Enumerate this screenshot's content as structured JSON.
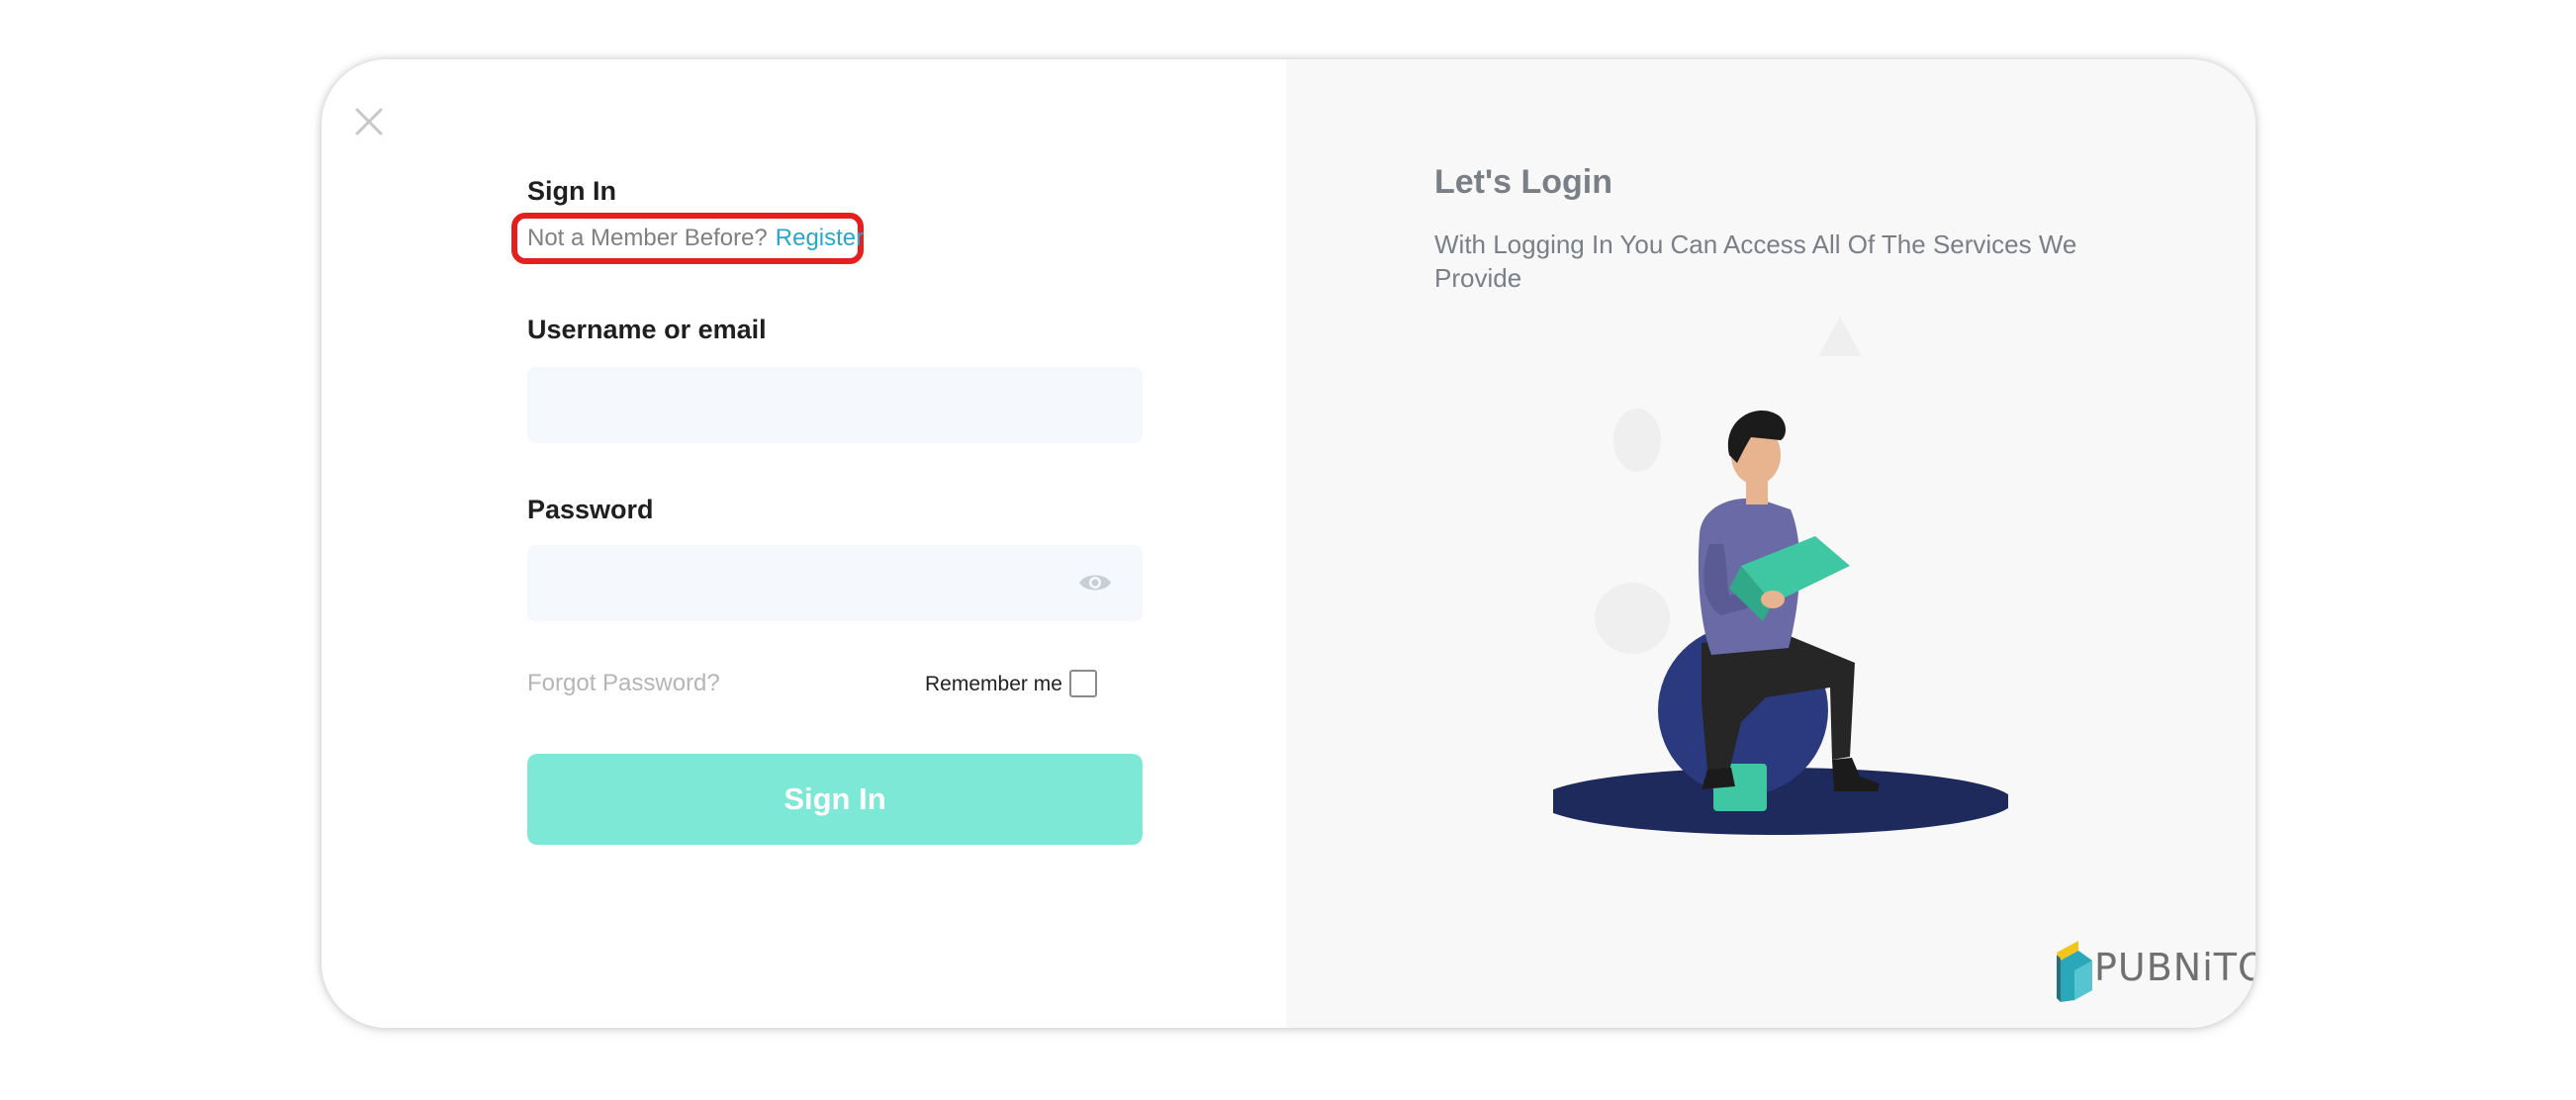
{
  "left_panel": {
    "title": "Sign In",
    "member_prompt": "Not a Member Before?",
    "register_link": "Register",
    "username_label": "Username or email",
    "username_value": "",
    "password_label": "Password",
    "password_value": "",
    "forgot_password": "Forgot Password?",
    "remember_me": "Remember me",
    "remember_checked": false,
    "signin_button": "Sign In"
  },
  "right_panel": {
    "title": "Let's Login",
    "description": "With Logging In You Can Access All Of The Services We Provide"
  },
  "brand": {
    "logo_text": "PUBNiTO"
  },
  "icons": {
    "close": "close-icon",
    "password_visibility": "eye-icon",
    "checkbox": "checkbox-icon",
    "logo": "pubnito-logo"
  },
  "colors": {
    "register_link": "#2aa6c9",
    "signin_button": "#7ee8d6",
    "highlight_box": "#e51e1e",
    "right_panel_bg": "#f8f8f8",
    "input_bg": "#f5f8fd"
  }
}
